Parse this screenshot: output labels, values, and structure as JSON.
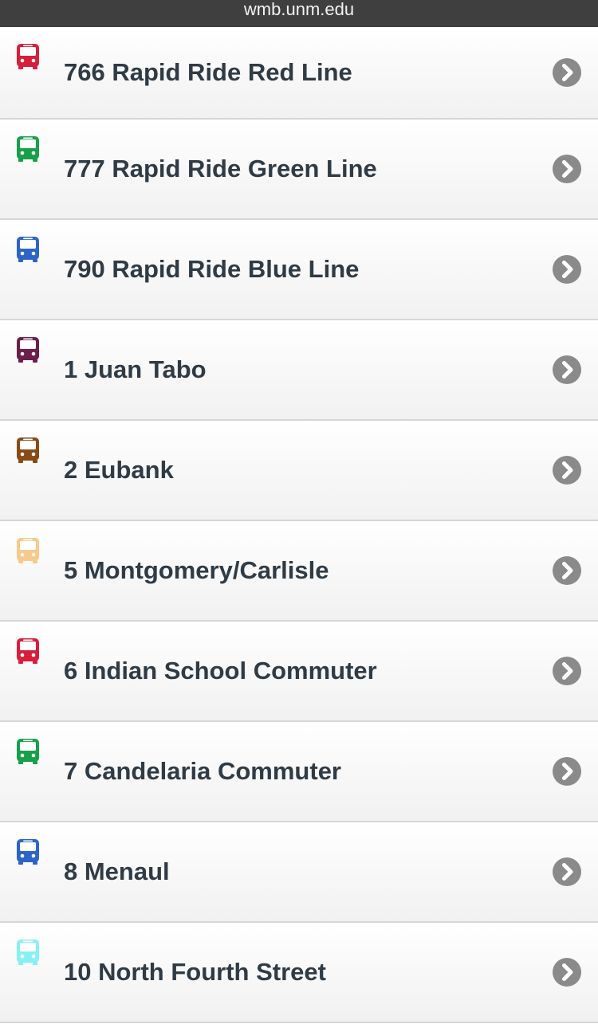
{
  "browser": {
    "url": "wmb.unm.edu"
  },
  "routes": [
    {
      "label": "766 Rapid Ride Red Line",
      "color": "#d71f3c",
      "icon": "bus-icon"
    },
    {
      "label": "777 Rapid Ride Green Line",
      "color": "#16a04a",
      "icon": "bus-icon"
    },
    {
      "label": "790 Rapid Ride Blue Line",
      "color": "#2d64c8",
      "icon": "bus-icon"
    },
    {
      "label": "1 Juan Tabo",
      "color": "#6b1f4a",
      "icon": "bus-icon"
    },
    {
      "label": "2 Eubank",
      "color": "#8a4a16",
      "icon": "bus-icon"
    },
    {
      "label": "5 Montgomery/Carlisle",
      "color": "#f7c98a",
      "icon": "bus-icon"
    },
    {
      "label": "6 Indian School Commuter",
      "color": "#d71f3c",
      "icon": "bus-icon"
    },
    {
      "label": "7 Candelaria Commuter",
      "color": "#16a04a",
      "icon": "bus-icon"
    },
    {
      "label": "8 Menaul",
      "color": "#2d64c8",
      "icon": "bus-icon"
    },
    {
      "label": "10 North Fourth Street",
      "color": "#86f0f2",
      "icon": "bus-icon"
    }
  ],
  "colors": {
    "chevron": "#8a8a8a",
    "text": "#2f3b45",
    "urlbar": "#3f3f3f"
  }
}
